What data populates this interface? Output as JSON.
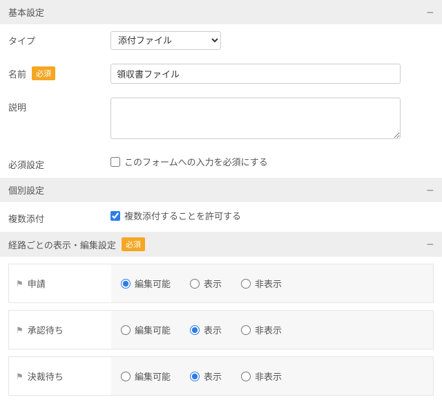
{
  "sections": {
    "basic": {
      "title": "基本設定"
    },
    "individual": {
      "title": "個別設定"
    },
    "route": {
      "title": "経路ごとの表示・編集設定",
      "required_badge": "必須"
    }
  },
  "form": {
    "type": {
      "label": "タイプ",
      "value": "添付ファイル"
    },
    "name": {
      "label": "名前",
      "required_badge": "必須",
      "value": "領収書ファイル"
    },
    "description": {
      "label": "説明",
      "value": ""
    },
    "required_setting": {
      "label": "必須設定",
      "checkbox_label": "このフォームへの入力を必須にする"
    },
    "multi_attach": {
      "label": "複数添付",
      "checkbox_label": "複数添付することを許可する"
    }
  },
  "radio_labels": {
    "editable": "編集可能",
    "show": "表示",
    "hide": "非表示"
  },
  "routes": [
    {
      "name": "申請",
      "selected": "editable"
    },
    {
      "name": "承認待ち",
      "selected": "show"
    },
    {
      "name": "決裁待ち",
      "selected": "show"
    }
  ]
}
